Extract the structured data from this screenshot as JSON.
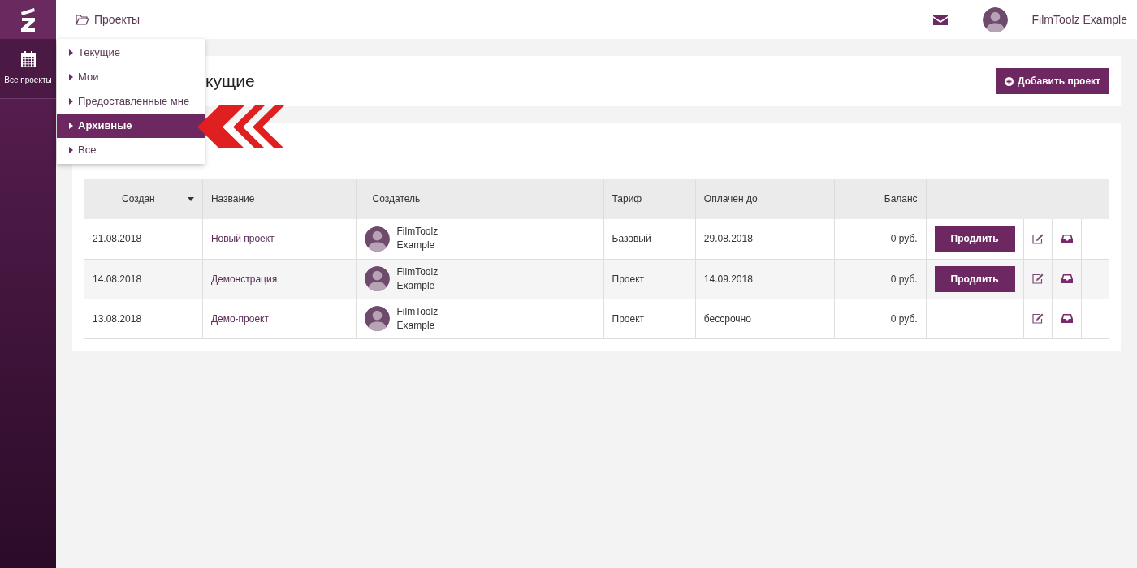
{
  "sidebar": {
    "items": [
      {
        "label": "Все проекты",
        "selected": true
      }
    ]
  },
  "topbar": {
    "breadcrumb": "Проекты",
    "user": "FilmToolz Example"
  },
  "dropdown": {
    "items": [
      {
        "label": "Текущие",
        "selected": false
      },
      {
        "label": "Мои",
        "selected": false
      },
      {
        "label": "Предоставленные мне",
        "selected": false
      },
      {
        "label": "Архивные",
        "selected": true
      },
      {
        "label": "Все",
        "selected": false
      }
    ]
  },
  "page": {
    "title": "кущие",
    "add_button": "Добавить проект"
  },
  "table": {
    "columns": [
      {
        "label": "Создан",
        "sorted": true
      },
      {
        "label": "Название",
        "sorted": false
      },
      {
        "label": "Создатель",
        "sorted": false
      },
      {
        "label": "Тариф",
        "sorted": false
      },
      {
        "label": "Оплачен до",
        "sorted": false
      },
      {
        "label": "Баланс",
        "sorted": false
      }
    ],
    "rows": [
      {
        "created": "21.08.2018",
        "name": "Новый проект",
        "creator": [
          "FilmToolz",
          "Example"
        ],
        "tariff": "Базовый",
        "paid_until": "29.08.2018",
        "balance": "0 руб.",
        "extend_button": "Продлить"
      },
      {
        "created": "14.08.2018",
        "name": "Демонстрация",
        "creator": [
          "FilmToolz",
          "Example"
        ],
        "tariff": "Проект",
        "paid_until": "14.09.2018",
        "balance": "0 руб.",
        "extend_button": "Продлить"
      },
      {
        "created": "13.08.2018",
        "name": "Демо-проект",
        "creator": [
          "FilmToolz",
          "Example"
        ],
        "tariff": "Проект",
        "paid_until": "бессрочно",
        "balance": "0 руб."
      }
    ]
  }
}
